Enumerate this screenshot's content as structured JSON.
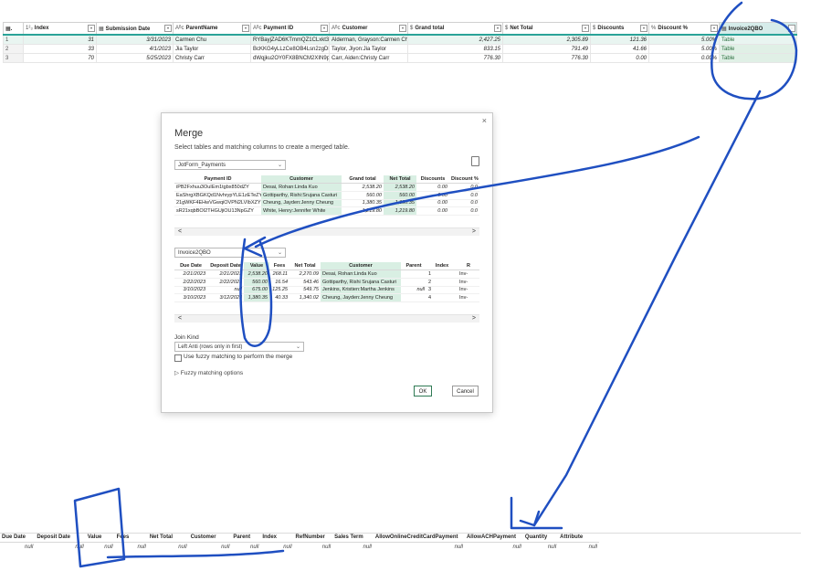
{
  "main_grid": {
    "columns": [
      {
        "label": "Index",
        "type_icon": "1²₃"
      },
      {
        "label": "Submission Date",
        "type_icon": "▦"
      },
      {
        "label": "ParentName",
        "type_icon": "Aᴮc"
      },
      {
        "label": "Payment ID",
        "type_icon": "Aᴮc"
      },
      {
        "label": "Customer",
        "type_icon": "Aᴮc"
      },
      {
        "label": "Grand total",
        "type_icon": "$"
      },
      {
        "label": "Net Total",
        "type_icon": "$"
      },
      {
        "label": "Discounts",
        "type_icon": "$"
      },
      {
        "label": "Discount %",
        "type_icon": "%"
      },
      {
        "label": "Invoice2QBO",
        "type_icon": "▦"
      }
    ],
    "rows": [
      {
        "n": "1",
        "index": "31",
        "date": "3/31/2023",
        "parent": "Carmen Chu",
        "payment_id": "RYBayjZAD6KTmmQZ1CLxkt359N...",
        "customer": "Alderman, Grayson:Carmen Chu",
        "grand": "2,427.25",
        "net": "2,305.89",
        "disc": "121.36",
        "pct": "5.00%",
        "inv": "Table"
      },
      {
        "n": "2",
        "index": "33",
        "date": "4/1/2023",
        "parent": "Jia Taylor",
        "payment_id": "BcKKG4yLLzCe8OB4Lsn2zgDFj6c2Y",
        "customer": "Taylor, Jiyon:Jia Taylor",
        "grand": "833.15",
        "net": "791.49",
        "disc": "41.66",
        "pct": "5.00%",
        "inv": "Table"
      },
      {
        "n": "3",
        "index": "70",
        "date": "5/25/2023",
        "parent": "Christy Carr",
        "payment_id": "dWqjku2OY0FX8BNCM2XIN9pUJ...",
        "customer": "Carr, Aiden:Christy Carr",
        "grand": "776.30",
        "net": "776.30",
        "disc": "0.00",
        "pct": "0.00%",
        "inv": "Table"
      }
    ]
  },
  "dialog": {
    "close_glyph": "×",
    "title": "Merge",
    "subtitle": "Select tables and matching columns to create a merged table.",
    "first_table": "JotForm_Payments",
    "second_table": "Invoice2QBO",
    "first_preview": {
      "columns": [
        "Payment ID",
        "Customer",
        "Grand total",
        "Net Total",
        "Discounts",
        "Discount %"
      ],
      "rows": [
        [
          "iPB2Fxhuu3OuIEm1tgbx850dZY",
          "Desai, Rohan:Linda Kuo",
          "2,538.20",
          "2,538.20",
          "0.00",
          "0.0"
        ],
        [
          "EaShrgXBGKQd1NvhrypYLE1zETeZY",
          "Gottiparthy, Rishi:Srujana Casturi",
          "560.00",
          "560.00",
          "0.00",
          "0.0"
        ],
        [
          "21gWKF4EHwVGwqiOVPN2LVIbXZY",
          "Cheung, Jayden:Jenny Cheung",
          "1,380.35",
          "1,380.35",
          "0.00",
          "0.0"
        ],
        [
          "sR21xqbBOI2THGUjiOU13NpGZY",
          "White, Henry:Jennifer White",
          "1,219.80",
          "1,219.80",
          "0.00",
          "0.0"
        ]
      ]
    },
    "second_preview": {
      "columns": [
        "Due Date",
        "Deposit Date",
        "Value",
        "Fees",
        "Net Total",
        "Customer",
        "Parent",
        "Index",
        "R"
      ],
      "rows": [
        [
          "2/21/2023",
          "2/21/2023",
          "2,538.20",
          "268.11",
          "2,270.09",
          "Desai, Rohan:Linda Kuo",
          "",
          "1",
          "Inv-"
        ],
        [
          "2/22/2023",
          "2/22/2023",
          "560.00",
          "16.54",
          "543.46",
          "Gottiparthy, Rishi Srujana Casturi",
          "",
          "2",
          "Inv-"
        ],
        [
          "3/10/2023",
          "null",
          "675.00",
          "125.25",
          "549.75",
          "Jenkins, Kristien:Martha Jenkins",
          "null",
          "3",
          "Inv-"
        ],
        [
          "3/10/2023",
          "3/12/2023",
          "1,380.35",
          "40.33",
          "1,340.02",
          "Cheung, Jayden:Jenny Cheung",
          "",
          "4",
          "Inv-"
        ]
      ]
    },
    "join_kind_label": "Join Kind",
    "join_kind_value": "Left Anti (rows only in first)",
    "fuzzy_checkbox_label": "Use fuzzy matching to perform the merge",
    "fuzzy_options_label": "▷ Fuzzy matching options",
    "ok_label": "OK",
    "cancel_label": "Cancel"
  },
  "bottom_grid": {
    "columns": [
      "Due Date",
      "Deposit Date",
      "Value",
      "Fees",
      "Net Total",
      "Customer",
      "Parent",
      "Index",
      "RefNumber",
      "Sales Term",
      "AllowOnlineCreditCardPayment",
      "AllowACHPayment",
      "Quantity",
      "Attribute"
    ],
    "row": [
      "null",
      "null",
      "null",
      "null",
      "null",
      "null",
      "null",
      "null",
      "null",
      "null",
      "null",
      "null",
      "null",
      "null"
    ]
  },
  "colors": {
    "accent": "#2aa398",
    "highlight": "#d9efe3",
    "annotation": "#1f4fc1"
  }
}
